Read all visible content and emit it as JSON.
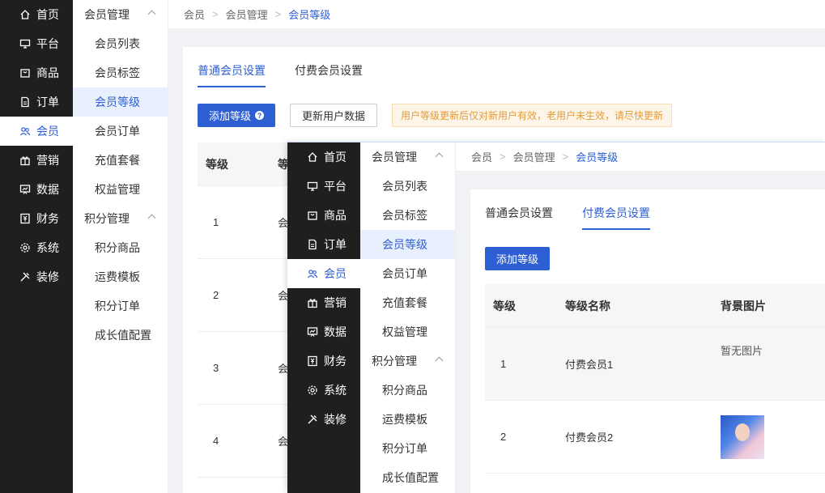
{
  "primary_nav": [
    {
      "label": "首页",
      "icon": "home-icon"
    },
    {
      "label": "平台",
      "icon": "monitor-icon"
    },
    {
      "label": "商品",
      "icon": "bag-icon"
    },
    {
      "label": "订单",
      "icon": "document-icon"
    },
    {
      "label": "会员",
      "icon": "users-icon"
    },
    {
      "label": "营销",
      "icon": "gift-icon"
    },
    {
      "label": "数据",
      "icon": "chart-screen-icon"
    },
    {
      "label": "财务",
      "icon": "yuan-icon"
    },
    {
      "label": "系统",
      "icon": "gear-icon"
    },
    {
      "label": "装修",
      "icon": "tools-icon"
    }
  ],
  "secondary_nav": {
    "group1": "会员管理",
    "group1_items": [
      "会员列表",
      "会员标签",
      "会员等级",
      "会员订单",
      "充值套餐",
      "权益管理"
    ],
    "group2": "积分管理",
    "group2_items": [
      "积分商品",
      "运费模板",
      "积分订单",
      "成长值配置"
    ]
  },
  "breadcrumb": [
    "会员",
    "会员管理",
    "会员等级"
  ],
  "back": {
    "tabs": [
      "普通会员设置",
      "付费会员设置"
    ],
    "add_button": "添加等级",
    "update_button": "更新用户数据",
    "notice": "用户等级更新后仅对新用户有效，老用户未生效，请尽快更新",
    "col_level": "等级",
    "col_name_partial": "等",
    "rows": [
      {
        "level": "1",
        "name_partial": "会"
      },
      {
        "level": "2",
        "name_partial": "会"
      },
      {
        "level": "3",
        "name_partial": "会"
      },
      {
        "level": "4",
        "name_partial": "会"
      }
    ]
  },
  "front": {
    "tabs": [
      "普通会员设置",
      "付费会员设置"
    ],
    "add_button": "添加等级",
    "columns": [
      "等级",
      "等级名称",
      "背景图片"
    ],
    "rows": [
      {
        "level": "1",
        "name": "付费会员1",
        "image": "暂无图片"
      },
      {
        "level": "2",
        "name": "付费会员2",
        "image": ""
      }
    ]
  },
  "colors": {
    "accent": "#2d5fd3",
    "nav_bg": "#1f1f1f",
    "notice_text": "#e49b3a"
  }
}
